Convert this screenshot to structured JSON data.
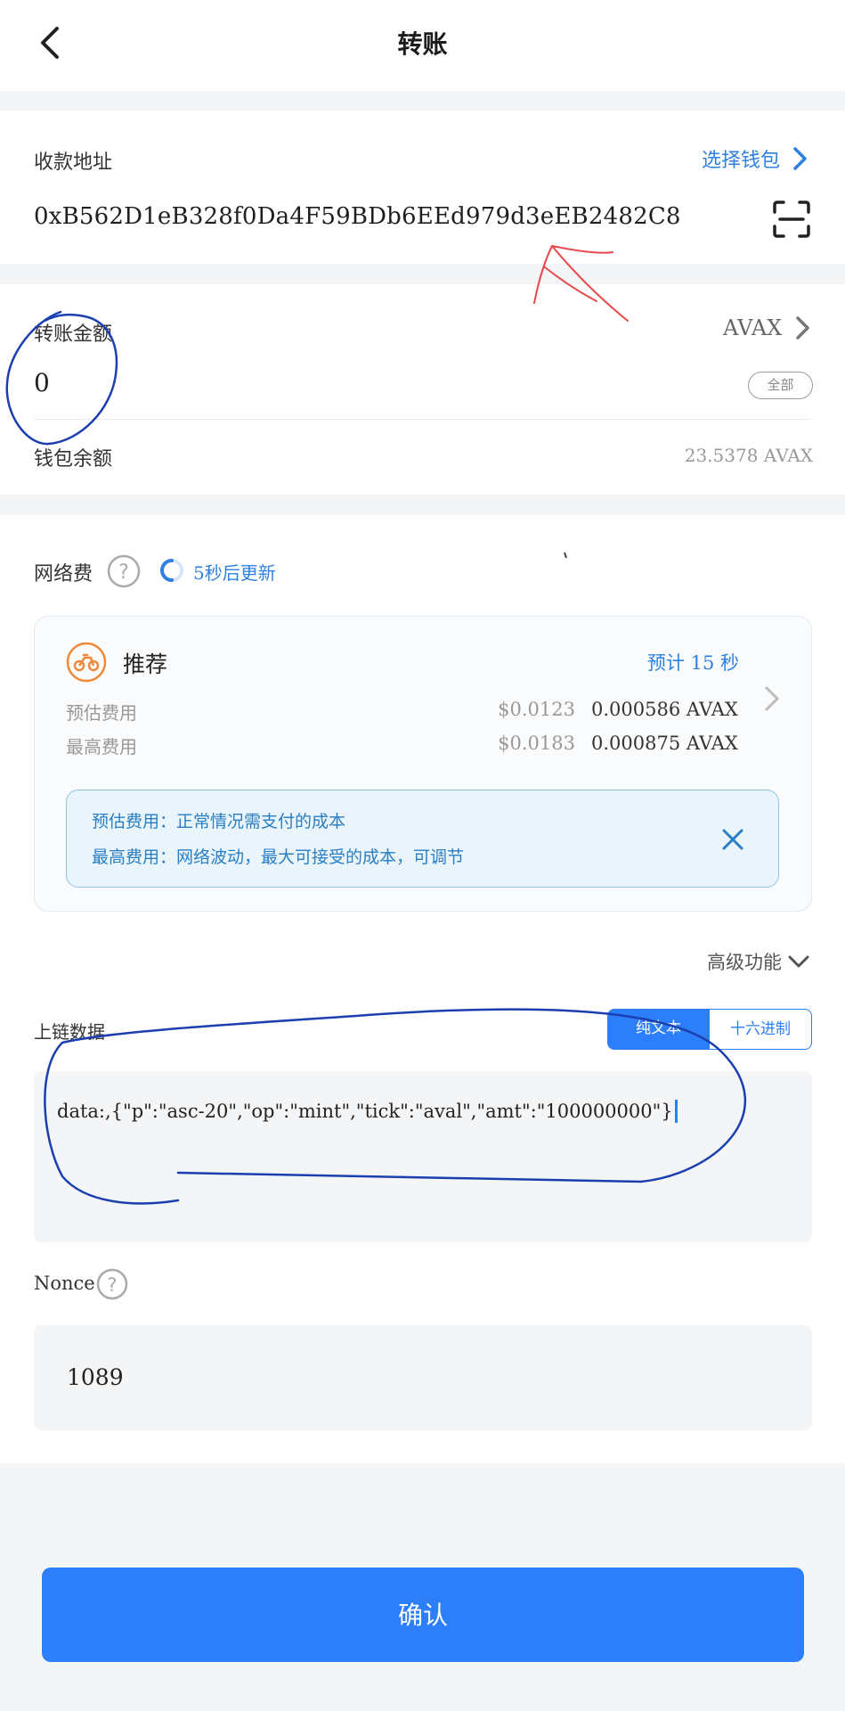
{
  "header": {
    "title": "转账"
  },
  "recipient": {
    "label": "收款地址",
    "select_wallet_label": "选择钱包",
    "address": "0xB562D1eB328f0Da4F59BDb6EEd979d3eEB2482C8"
  },
  "amount": {
    "label": "转账金额",
    "token": "AVAX",
    "value": "0",
    "all_button": "全部",
    "balance_label": "钱包余额",
    "balance_value": "23.5378 AVAX"
  },
  "network_fee": {
    "label": "网络费",
    "refresh_text": "5秒后更新",
    "plan": {
      "name": "推荐",
      "eta": "预计 15 秒",
      "estimated_label": "预估费用",
      "estimated_usd": "$0.0123",
      "estimated_avax": "0.000586 AVAX",
      "max_label": "最高费用",
      "max_usd": "$0.0183",
      "max_avax": "0.000875 AVAX"
    },
    "info": {
      "line1": "预估费用：正常情况需支付的成本",
      "line2": "最高费用：网络波动，最大可接受的成本，可调节"
    }
  },
  "advanced": {
    "label": "高级功能"
  },
  "chain_data": {
    "label": "上链数据",
    "tab_text": "纯文本",
    "tab_hex": "十六进制",
    "active_tab": "纯文本",
    "value": "data:,{\"p\":\"asc-20\",\"op\":\"mint\",\"tick\":\"aval\",\"amt\":\"100000000\"}"
  },
  "nonce": {
    "label": "Nonce",
    "value": "1089"
  },
  "footer": {
    "confirm_label": "确认"
  },
  "colors": {
    "accent": "#2d7ff9",
    "link": "#2f80e0",
    "fee_icon": "#f08a3a",
    "annotation_red": "#e8484b",
    "annotation_blue": "#1b3fb0"
  }
}
